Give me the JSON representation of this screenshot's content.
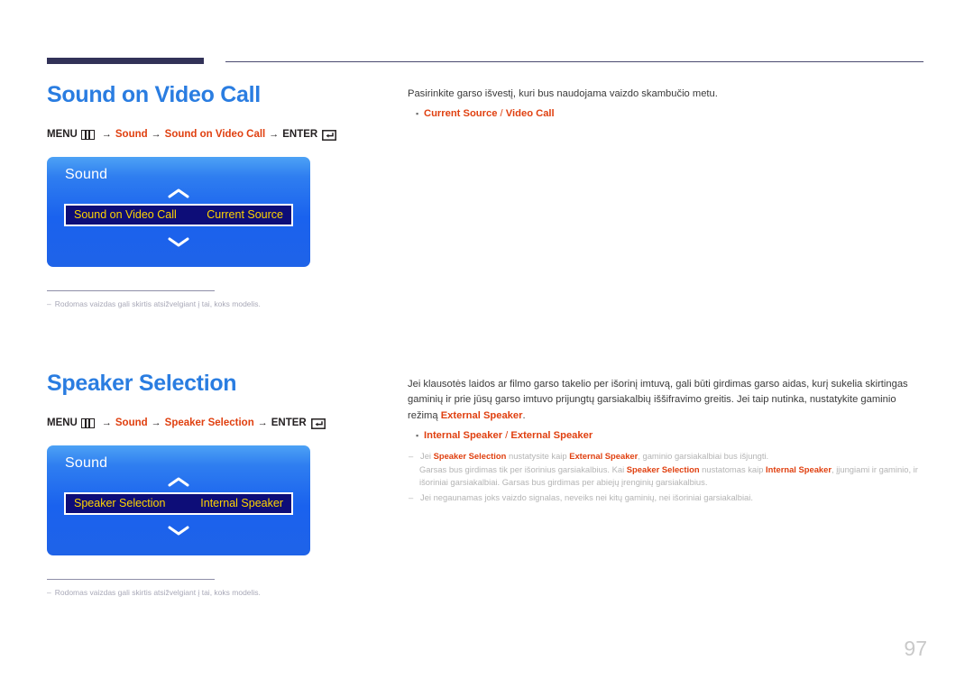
{
  "page": {
    "number": "97"
  },
  "sections": [
    {
      "title": "Sound on Video Call",
      "menu_path": {
        "menu_label": "MENU",
        "menu_icon": "menu-grid-icon",
        "arrow": "→",
        "step1": "Sound",
        "step2": "Sound on Video Call",
        "enter_label": "ENTER",
        "enter_icon": "enter-return-icon"
      },
      "osd": {
        "title": "Sound",
        "up_icon": "chevron-up-icon",
        "down_icon": "chevron-down-icon",
        "row_label": "Sound on Video Call",
        "row_value": "Current Source"
      },
      "footnote": {
        "dash": "‒",
        "text": "Rodomas vaizdas gali skirtis atsižvelgiant į tai, koks modelis."
      },
      "right": {
        "intro": "Pasirinkite garso išvestį, kuri bus naudojama vaizdo skambučio metu.",
        "bullet_dot": "▪",
        "option_a": "Current Source",
        "option_sep": " / ",
        "option_b": "Video Call"
      }
    },
    {
      "title": "Speaker Selection",
      "menu_path": {
        "menu_label": "MENU",
        "menu_icon": "menu-grid-icon",
        "arrow": "→",
        "step1": "Sound",
        "step2": "Speaker Selection",
        "enter_label": "ENTER",
        "enter_icon": "enter-return-icon"
      },
      "osd": {
        "title": "Sound",
        "up_icon": "chevron-up-icon",
        "down_icon": "chevron-down-icon",
        "row_label": "Speaker Selection",
        "row_value": "Internal Speaker"
      },
      "footnote": {
        "dash": "‒",
        "text": "Rodomas vaizdas gali skirtis atsižvelgiant į tai, koks modelis."
      },
      "right": {
        "intro_part1": "Jei klausotės laidos ar filmo garso takelio per išorinį imtuvą, gali būti girdimas garso aidas, kurį sukelia skirtingas gaminių ir prie jūsų garso imtuvo prijungtų garsiakalbių iššifravimo greitis. Jei taip nutinka, nustatykite gaminio režimą ",
        "intro_accent": "External Speaker",
        "intro_part2": ".",
        "bullet_dot": "▪",
        "option_a": "Internal Speaker",
        "option_sep": " / ",
        "option_b": "External Speaker",
        "notes": [
          {
            "dash": "‒",
            "segments": [
              {
                "text": "Jei ",
                "accent": false
              },
              {
                "text": "Speaker Selection",
                "accent": true
              },
              {
                "text": " nustatysite kaip ",
                "accent": false
              },
              {
                "text": "External Speaker",
                "accent": true
              },
              {
                "text": ", gaminio garsiakalbiai bus išjungti.",
                "accent": false
              }
            ],
            "sub_segments": [
              {
                "text": "Garsas bus girdimas tik per išorinius garsiakalbius. Kai ",
                "accent": false
              },
              {
                "text": "Speaker Selection",
                "accent": true
              },
              {
                "text": " nustatomas kaip ",
                "accent": false
              },
              {
                "text": "Internal Speaker",
                "accent": true
              },
              {
                "text": ", įjungiami ir gaminio, ir išoriniai garsiakalbiai. Garsas bus girdimas per abiejų įrenginių garsiakalbius.",
                "accent": false
              }
            ]
          },
          {
            "dash": "‒",
            "segments": [
              {
                "text": "Jei negaunamas joks vaizdo signalas, neveiks nei kitų gaminių, nei išoriniai garsiakalbiai.",
                "accent": false
              }
            ],
            "sub_segments": []
          }
        ]
      }
    }
  ],
  "colors": {
    "title_blue": "#2a7de1",
    "accent_orange": "#e04010",
    "osd_blue": "#1a62ee",
    "osd_row_navy": "#0d0d78",
    "osd_row_text": "#ffd400",
    "rule_navy": "#323258"
  }
}
